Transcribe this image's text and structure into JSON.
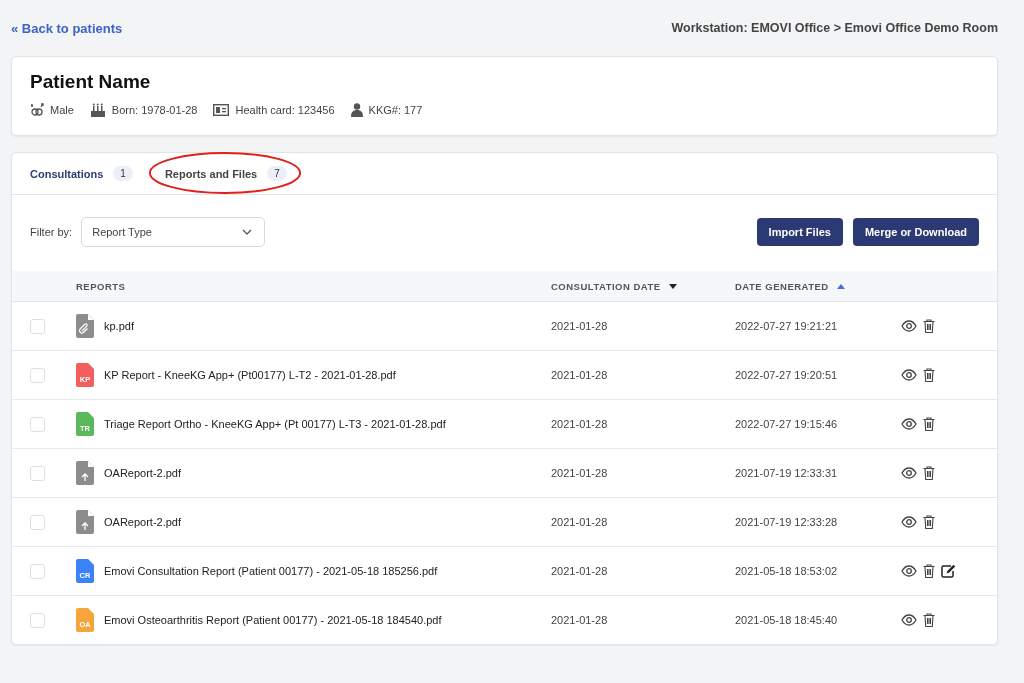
{
  "back_link": "« Back to patients",
  "workstation": "Workstation: EMOVI Office > Emovi Office Demo Room",
  "patient": {
    "name": "Patient Name",
    "facts": [
      {
        "kind": "gender",
        "text": "Male"
      },
      {
        "kind": "born",
        "text": "Born: 1978-01-28"
      },
      {
        "kind": "card",
        "text": "Health card: 123456"
      },
      {
        "kind": "person",
        "text": "KKG#: 177"
      }
    ]
  },
  "tabs": [
    {
      "label": "Consultations",
      "count": "1",
      "selected": false,
      "circled": false
    },
    {
      "label": "Reports and Files",
      "count": "7",
      "selected": true,
      "circled": true
    }
  ],
  "filter": {
    "label": "Filter by:",
    "placeholder": "Report Type"
  },
  "buttons": [
    "Import Files",
    "Merge or Download"
  ],
  "table": {
    "columns": [
      {
        "label": "REPORTS"
      },
      {
        "label": "CONSULTATION DATE",
        "ascending": false,
        "active": false
      },
      {
        "label": "DATE GENERATED",
        "ascending": true,
        "active": true
      }
    ],
    "rows": [
      {
        "checked": false,
        "icon": {
          "kind": "attachment"
        },
        "name": "kp.pdf",
        "consultation_date": "2021-01-28",
        "generated": "2022-07-27 19:21:21",
        "editable": false
      },
      {
        "checked": false,
        "icon": {
          "kind": "tag",
          "label": "KP",
          "color": "#f25f5c"
        },
        "name": "KP Report - KneeKG App+ (Pt00177) L-T2 - 2021-01-28.pdf",
        "consultation_date": "2021-01-28",
        "generated": "2022-07-27 19:20:51",
        "editable": false
      },
      {
        "checked": false,
        "icon": {
          "kind": "tag",
          "label": "TR",
          "color": "#5cb85c"
        },
        "name": "Triage Report Ortho - KneeKG App+ (Pt 00177) L-T3 - 2021-01-28.pdf",
        "consultation_date": "2021-01-28",
        "generated": "2022-07-27 19:15:46",
        "editable": false
      },
      {
        "checked": false,
        "icon": {
          "kind": "upload"
        },
        "name": "OAReport-2.pdf",
        "consultation_date": "2021-01-28",
        "generated": "2021-07-19 12:33:31",
        "editable": false
      },
      {
        "checked": false,
        "icon": {
          "kind": "upload"
        },
        "name": "OAReport-2.pdf",
        "consultation_date": "2021-01-28",
        "generated": "2021-07-19 12:33:28",
        "editable": false
      },
      {
        "checked": false,
        "icon": {
          "kind": "tag",
          "label": "CR",
          "color": "#3b82f6"
        },
        "name": "Emovi Consultation Report (Patient 00177) - 2021-05-18 185256.pdf",
        "consultation_date": "2021-01-28",
        "generated": "2021-05-18 18:53:02",
        "editable": true
      },
      {
        "checked": false,
        "icon": {
          "kind": "tag",
          "label": "OA",
          "color": "#f5a53c"
        },
        "name": "Emovi Osteoarthritis Report (Patient 00177) - 2021-05-18 184540.pdf",
        "consultation_date": "2021-01-28",
        "generated": "2021-05-18 18:45:40",
        "editable": false
      }
    ]
  }
}
